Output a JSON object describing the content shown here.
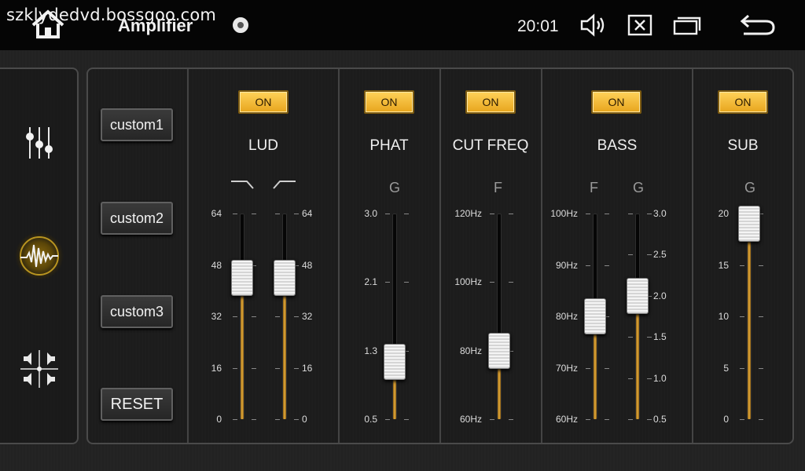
{
  "topbar": {
    "watermark": "szklydedvd.bossgoo.com",
    "title": "Amplifier",
    "clock": "20:01",
    "icons": [
      "home-icon",
      "status-dot-icon",
      "volume-icon",
      "close-box-icon",
      "recent-apps-icon",
      "back-icon"
    ]
  },
  "sidenav": {
    "items": [
      {
        "name": "equalizer-sliders-icon",
        "active": false
      },
      {
        "name": "waveform-icon",
        "active": true
      },
      {
        "name": "balance-fader-icon",
        "active": false
      }
    ]
  },
  "presets": {
    "custom1": "custom1",
    "custom2": "custom2",
    "custom3": "custom3",
    "reset": "RESET"
  },
  "sections": {
    "lud": {
      "title": "LUD",
      "toggle": "ON",
      "ticks": [
        "64",
        "48",
        "32",
        "16",
        "0"
      ],
      "sliders": [
        {
          "name": "low",
          "value": 44,
          "min": 0,
          "max": 64
        },
        {
          "name": "high",
          "value": 44,
          "min": 0,
          "max": 64
        }
      ]
    },
    "phat": {
      "title": "PHAT",
      "toggle": "ON",
      "label": "G",
      "ticks": [
        "3.0",
        "2.1",
        "1.3",
        "0.5"
      ],
      "value": 1.2,
      "min": 0.5,
      "max": 3.0
    },
    "cutfreq": {
      "title": "CUT FREQ",
      "toggle": "ON",
      "label": "F",
      "ticks": [
        "120Hz",
        "100Hz",
        "80Hz",
        "60Hz"
      ],
      "value": 80,
      "min": 60,
      "max": 120
    },
    "bass": {
      "title": "BASS",
      "toggle": "ON",
      "label_f": "F",
      "label_g": "G",
      "ticks_f": [
        "100Hz",
        "90Hz",
        "80Hz",
        "70Hz",
        "60Hz"
      ],
      "ticks_g": [
        "3.0",
        "2.5",
        "2.0",
        "1.5",
        "1.0",
        "0.5"
      ],
      "value_f": 80,
      "min_f": 60,
      "max_f": 100,
      "value_g": 2.0,
      "min_g": 0.5,
      "max_g": 3.0
    },
    "sub": {
      "title": "SUB",
      "toggle": "ON",
      "label": "G",
      "ticks": [
        "20",
        "15",
        "10",
        "5",
        "0"
      ],
      "value": 19,
      "min": 0,
      "max": 20
    }
  },
  "colors": {
    "accent": "#f3b63a",
    "toggle_on": "#ffd25a",
    "background": "#1c1c1c"
  }
}
